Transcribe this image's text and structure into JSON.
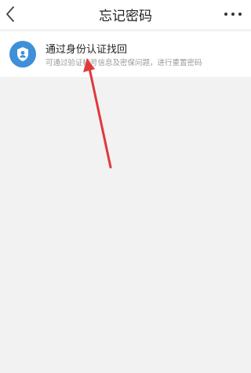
{
  "header": {
    "title": "忘记密码",
    "back_icon": "chevron-left-icon",
    "more_icon": "more-horizontal-icon"
  },
  "options": [
    {
      "icon": "shield-user-icon",
      "title": "通过身份认证找回",
      "description": "可通过验证帐号信息及密保问题，进行重置密码"
    }
  ],
  "colors": {
    "background": "#f2f2f2",
    "accent": "#3f8fd9",
    "annotation": "#e0393c"
  }
}
